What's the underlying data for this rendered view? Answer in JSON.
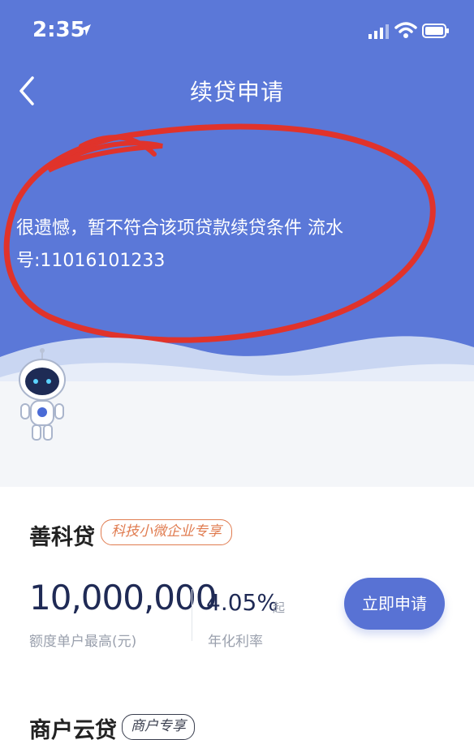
{
  "status_bar": {
    "time": "2:35"
  },
  "nav": {
    "title": "续贷申请"
  },
  "message": {
    "text": "很遗憾，暂不符合该项贷款续贷条件 流水号:11016101233"
  },
  "products": [
    {
      "name": "善科贷",
      "tag": "科技小微企业专享",
      "amount": "10,000,000",
      "amount_label": "额度单户最高(元)",
      "rate": "4.05%",
      "rate_suffix": "起",
      "rate_label": "年化利率",
      "button": "立即申请"
    },
    {
      "name": "商户云贷",
      "tag": "商户专享"
    }
  ],
  "colors": {
    "hero_bg": "#5b78d8",
    "accent_button": "#5872d4",
    "annotation_red": "#e0332b",
    "tag_orange": "#e07b4f"
  }
}
